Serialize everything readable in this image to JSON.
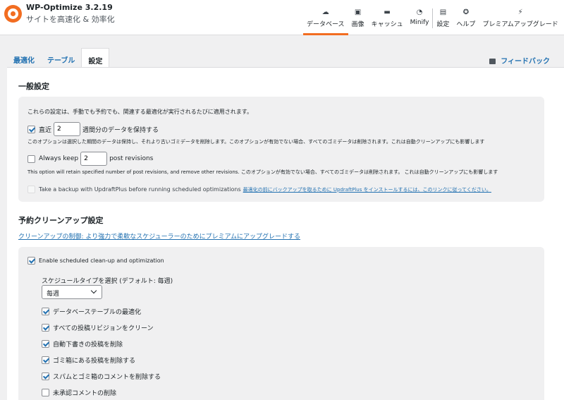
{
  "header": {
    "title": "WP-Optimize 3.2.19",
    "subtitle": "サイトを高速化 & 効率化"
  },
  "topnav": [
    {
      "label": "データベース",
      "icon": "database-icon",
      "active": true
    },
    {
      "label": "画像",
      "icon": "image-icon"
    },
    {
      "label": "キャッシュ",
      "icon": "cache-icon"
    },
    {
      "label": "Minify",
      "icon": "gauge-icon"
    },
    {
      "label": "設定",
      "icon": "settings-icon"
    },
    {
      "label": "ヘルプ",
      "icon": "help-icon"
    },
    {
      "label": "プレミアムアップグレード",
      "icon": "plug-icon"
    }
  ],
  "tabs": [
    {
      "label": "最適化"
    },
    {
      "label": "テーブル"
    },
    {
      "label": "設定",
      "active": true
    }
  ],
  "feedback": "フィードバック",
  "general": {
    "heading": "一般設定",
    "intro": "これらの設定は、手動でも予約でも、関連する最適化が実行されるたびに適用されます。",
    "keep_weeks": {
      "checked": true,
      "prefix": "直近",
      "value": "2",
      "suffix": "週間分のデータを保持する",
      "note": "このオプションは選択した期間のデータは保持し、それより古いゴミデータを削除します。このオプションが有効でない場合、すべてのゴミデータは削除されます。これは自動クリーンアップにも影響します"
    },
    "keep_revisions": {
      "checked": false,
      "prefix": "Always keep",
      "value": "2",
      "suffix": "post revisions",
      "note": "This option will retain specified number of post revisions, and remove other revisions. このオプションが有効でない場合、すべてのゴミデータは削除されます。 これは自動クリーンアップにも影響します"
    },
    "backup": {
      "label": "Take a backup with UpdraftPlus before running scheduled optimizations",
      "link": "最適化の前にバックアップを取るために UpdraftPlus をインストールするには、このリンクに従ってください。"
    }
  },
  "scheduled": {
    "heading": "予約クリーンアップ設定",
    "premium_link": "クリーンアップの制御: より強力で柔軟なスケジューラーのためにプレミアムにアップグレードする",
    "enable_label": "Enable scheduled clean-up and optimization",
    "schedule_type_label": "スケジュールタイプを選択 (デフォルト: 毎週)",
    "schedule_value": "毎週",
    "options": [
      {
        "label": "データベーステーブルの最適化",
        "checked": true
      },
      {
        "label": "すべての投稿リビジョンをクリーン",
        "checked": true
      },
      {
        "label": "自動下書きの投稿を削除",
        "checked": true
      },
      {
        "label": "ゴミ箱にある投稿を削除する",
        "checked": true
      },
      {
        "label": "スパムとゴミ箱のコメントを削除する",
        "checked": true
      },
      {
        "label": "未承認コメントの削除",
        "checked": false
      }
    ]
  }
}
